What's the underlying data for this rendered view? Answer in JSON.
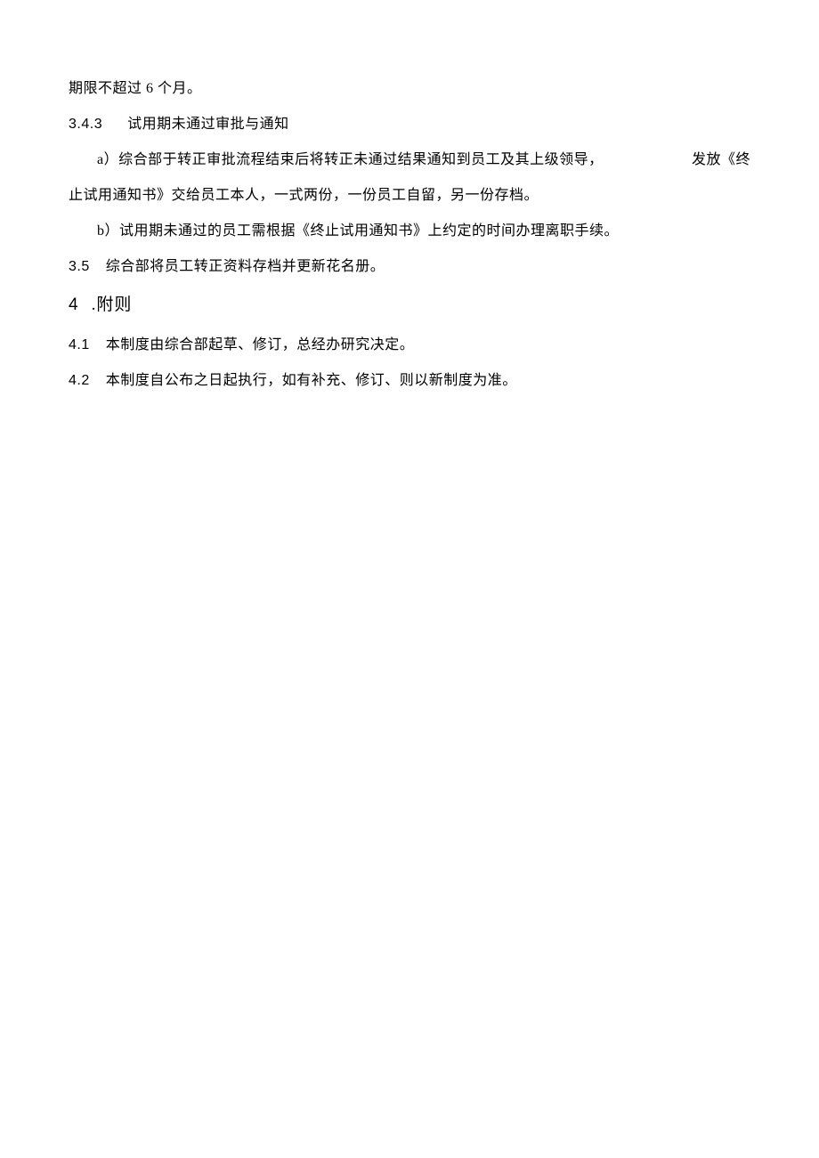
{
  "body": {
    "line1": "期限不超过 6 个月。",
    "item343_num": "3.4.3",
    "item343_text": "试用期未通过审批与通知",
    "line3_left": "a）综合部于转正审批流程结束后将转正未通过结果通知到员工及其上级领导，",
    "line3_right": "发放《终",
    "line4": "止试用通知书》交给员工本人，一式两份，一份员工自留，另一份存档。",
    "line5": "b）试用期未通过的员工需根据《终止试用通知书》上约定的时间办理离职手续。",
    "item35_num": "3.5",
    "item35_text": "综合部将员工转正资料存档并更新花名册。",
    "section4_num": "4",
    "section4_text": ".附则",
    "item41_num": "4.1",
    "item41_text": "本制度由综合部起草、修订，总经办研究决定。",
    "item42_num": "4.2",
    "item42_text": "本制度自公布之日起执行，如有补充、修订、则以新制度为准。"
  }
}
